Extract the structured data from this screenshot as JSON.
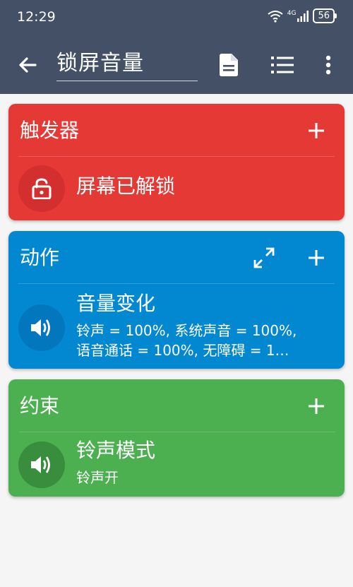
{
  "status_bar": {
    "time": "12:29",
    "network": "4G",
    "battery": "56"
  },
  "app_bar": {
    "title": "锁屏音量",
    "icons": [
      "back-arrow-icon",
      "document-icon",
      "list-icon",
      "more-vert-icon"
    ]
  },
  "colors": {
    "app_bar": "#435066",
    "trigger": "#e53935",
    "action": "#0288d1",
    "constraint": "#4caf50"
  },
  "trigger_section": {
    "title": "触发器",
    "items": [
      {
        "title": "屏幕已解锁",
        "icon": "unlock-icon"
      }
    ]
  },
  "action_section": {
    "title": "动作",
    "items": [
      {
        "title": "音量变化",
        "line1": "铃声 = 100%, 系统声音 = 100%,",
        "line2": "语音通话 = 100%, 无障碍 = 1…",
        "icon": "volume-icon"
      }
    ]
  },
  "constraint_section": {
    "title": "约束",
    "items": [
      {
        "title": "铃声模式",
        "subtitle": "铃声开",
        "icon": "volume-icon"
      }
    ]
  }
}
